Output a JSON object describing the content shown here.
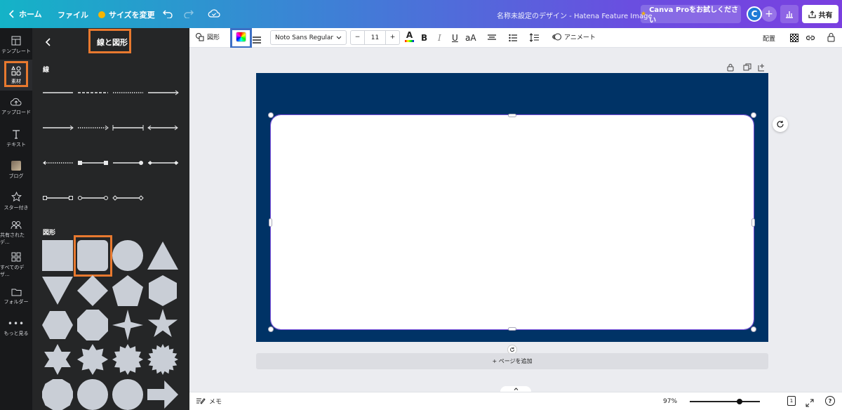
{
  "topbar": {
    "home": "ホーム",
    "file": "ファイル",
    "resize": "サイズを変更",
    "doc_title": "名称未設定のデザイン - Hatena Feature Image",
    "pro": "Canva Proをお試しください",
    "avatar": "C",
    "share": "共有"
  },
  "rail": [
    {
      "label": "テンプレート",
      "icon": "template-icon"
    },
    {
      "label": "素材",
      "icon": "elements-icon"
    },
    {
      "label": "アップロード",
      "icon": "upload-icon"
    },
    {
      "label": "テキスト",
      "icon": "text-icon"
    },
    {
      "label": "ブログ",
      "icon": "blog-icon"
    },
    {
      "label": "スター付き",
      "icon": "star-icon"
    },
    {
      "label": "共有されたデ...",
      "icon": "shared-icon"
    },
    {
      "label": "すべてのデザ...",
      "icon": "all-designs-icon"
    },
    {
      "label": "フォルダー",
      "icon": "folder-icon"
    },
    {
      "label": "もっと見る",
      "icon": "more-icon"
    }
  ],
  "panel": {
    "title": "線と図形",
    "lines_heading": "線",
    "shapes_heading": "図形"
  },
  "toolbar": {
    "shape_label": "図形",
    "font": "Noto Sans Regular",
    "font_size": "11",
    "minus": "−",
    "plus": "+",
    "animate": "アニメート",
    "position": "配置"
  },
  "canvas": {
    "bg_color": "#003366",
    "add_page": "+ ページを追加"
  },
  "bottombar": {
    "notes": "メモ",
    "zoom": "97%",
    "page_number": "1",
    "help": "?"
  }
}
